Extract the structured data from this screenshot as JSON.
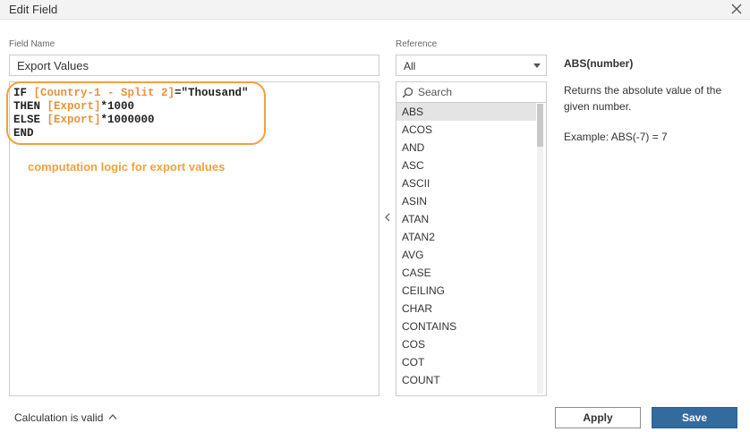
{
  "dialog": {
    "title": "Edit Field"
  },
  "field_name": {
    "label": "Field Name",
    "value": "Export Values"
  },
  "formula": {
    "line1_a": "IF ",
    "line1_field": "[Country-1 - Split 2]",
    "line1_b": "=\"Thousand\"",
    "line2_a": "THEN ",
    "line2_field": "[Export]",
    "line2_b": "*1000",
    "line3_a": "ELSE ",
    "line3_field": "[Export]",
    "line3_b": "*1000000",
    "line4": "END"
  },
  "annotation": {
    "text": "computation logic for export values",
    "color": "#f2a13d"
  },
  "reference": {
    "label": "Reference",
    "selected": "All",
    "search_placeholder": "Search",
    "functions": [
      "ABS",
      "ACOS",
      "AND",
      "ASC",
      "ASCII",
      "ASIN",
      "ATAN",
      "ATAN2",
      "AVG",
      "CASE",
      "CEILING",
      "CHAR",
      "CONTAINS",
      "COS",
      "COT",
      "COUNT"
    ],
    "selected_index": 0
  },
  "help": {
    "signature": "ABS(number)",
    "description": "Returns the absolute value of the given number.",
    "example": "Example: ABS(-7) = 7"
  },
  "footer": {
    "status": "Calculation is valid",
    "apply_label": "Apply",
    "save_label": "Save"
  },
  "colors": {
    "save_button": "#336b9e",
    "field_reference": "#e8923c"
  }
}
